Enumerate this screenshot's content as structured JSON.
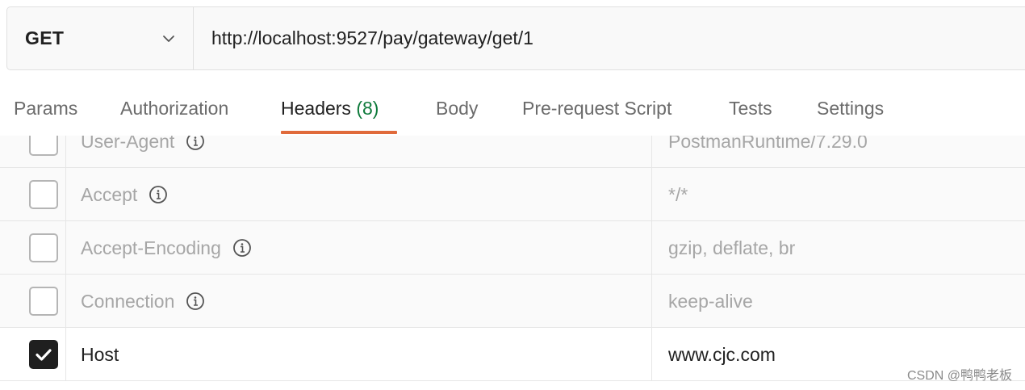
{
  "request": {
    "method": "GET",
    "url": "http://localhost:9527/pay/gateway/get/1"
  },
  "tabs": [
    {
      "label": "Params"
    },
    {
      "label": "Authorization"
    },
    {
      "label": "Headers",
      "count": "(8)",
      "active": true
    },
    {
      "label": "Body"
    },
    {
      "label": "Pre-request Script"
    },
    {
      "label": "Tests"
    },
    {
      "label": "Settings"
    }
  ],
  "headers": [
    {
      "key": "User-Agent",
      "value": "PostmanRuntime/7.29.0",
      "enabled": false,
      "info_icon": "info-icon"
    },
    {
      "key": "Accept",
      "value": "*/*",
      "enabled": false,
      "info_icon": "info-icon"
    },
    {
      "key": "Accept-Encoding",
      "value": "gzip, deflate, br",
      "enabled": false,
      "info_icon": "info-icon"
    },
    {
      "key": "Connection",
      "value": "keep-alive",
      "enabled": false,
      "info_icon": "info-icon"
    },
    {
      "key": "Host",
      "value": "www.cjc.com",
      "enabled": true
    }
  ],
  "watermark": "CSDN @鸭鸭老板",
  "colors": {
    "active_tab_underline": "#e06a3b",
    "tab_count": "#0e7a3b",
    "checkbox_checked": "#1f1f1f"
  }
}
